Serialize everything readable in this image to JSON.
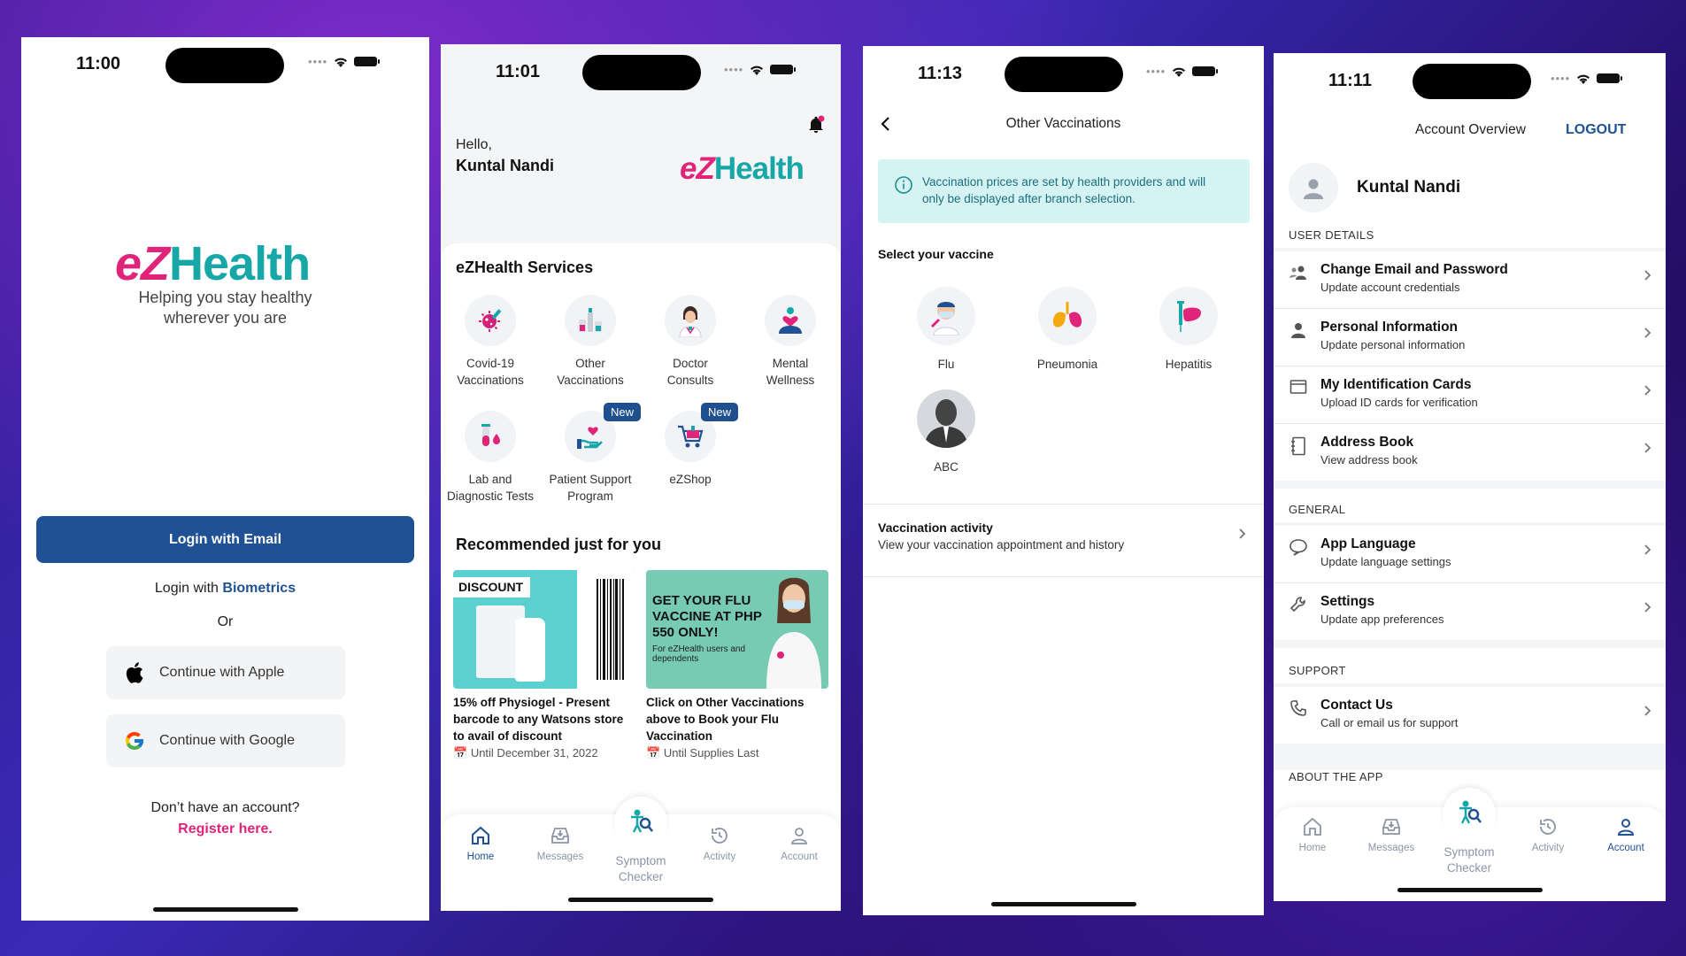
{
  "colors": {
    "brand_blue": "#1f5194",
    "brand_pink": "#e0247a",
    "brand_teal": "#18a7a7",
    "info_bg": "#d4f3f2"
  },
  "logo": {
    "ez": "eZ",
    "health": "Health"
  },
  "screen1": {
    "time": "11:00",
    "tagline_line1": "Helping you stay healthy",
    "tagline_line2": "wherever you are",
    "login_email": "Login with Email",
    "login_with": "Login with ",
    "biometrics": "Biometrics",
    "or": "Or",
    "apple": "Continue with Apple",
    "google": "Continue with Google",
    "no_account": "Don’t have an account?",
    "register": "Register here."
  },
  "screen2": {
    "time": "11:01",
    "hello": "Hello,",
    "user": "Kuntal Nandi",
    "services_title": "eZHealth Services",
    "services": [
      {
        "line1": "Covid-19",
        "line2": "Vaccinations",
        "icon": "virus-syringe-icon"
      },
      {
        "line1": "Other",
        "line2": "Vaccinations",
        "icon": "vaccine-vials-icon"
      },
      {
        "line1": "Doctor",
        "line2": "Consults",
        "icon": "doctor-icon"
      },
      {
        "line1": "Mental",
        "line2": "Wellness",
        "icon": "mental-wellness-icon"
      },
      {
        "line1": "Lab and",
        "line2": "Diagnostic Tests",
        "icon": "test-tube-icon"
      },
      {
        "line1": "Patient Support",
        "line2": "Program",
        "icon": "hand-heart-icon",
        "badge": "New"
      },
      {
        "line1": "eZShop",
        "line2": "",
        "icon": "shopping-cart-icon",
        "badge": "New"
      }
    ],
    "recommended_title": "Recommended just for you",
    "promo1": {
      "tag": "DISCOUNT",
      "text": "15% off Physiogel - Present barcode to any Watsons store to avail of discount",
      "until": "Until December 31, 2022"
    },
    "promo2": {
      "headline": "GET YOUR FLU VACCINE AT PHP 550 ONLY!",
      "sub": "For eZHealth users and dependents",
      "text": "Click on Other Vaccinations above to Book your Flu Vaccination",
      "until": "Until Supplies Last"
    },
    "tabs": {
      "home": "Home",
      "messages": "Messages",
      "symptom1": "Symptom",
      "symptom2": "Checker",
      "activity": "Activity",
      "account": "Account"
    }
  },
  "screen3": {
    "time": "11:13",
    "title": "Other Vaccinations",
    "info_line1": "Vaccination prices are set by health providers and will",
    "info_line2": "only be displayed after branch selection.",
    "select_label": "Select your vaccine",
    "vaccines": [
      {
        "label": "Flu"
      },
      {
        "label": "Pneumonia"
      },
      {
        "label": "Hepatitis"
      },
      {
        "label": "ABC"
      }
    ],
    "activity_title": "Vaccination activity",
    "activity_sub": "View your vaccination appointment and history"
  },
  "screen4": {
    "time": "11:11",
    "title": "Account Overview",
    "logout": "LOGOUT",
    "user": "Kuntal Nandi",
    "user_details": "USER DETAILS",
    "rows_user": [
      {
        "title": "Change Email and Password",
        "sub": "Update account credentials"
      },
      {
        "title": "Personal Information",
        "sub": "Update personal information"
      },
      {
        "title": "My Identification Cards",
        "sub": "Upload ID cards for verification"
      },
      {
        "title": "Address Book",
        "sub": "View address book"
      }
    ],
    "general": "GENERAL",
    "rows_general": [
      {
        "title": "App Language",
        "sub": "Update language settings"
      },
      {
        "title": "Settings",
        "sub": "Update app preferences"
      }
    ],
    "support": "SUPPORT",
    "rows_support": [
      {
        "title": "Contact Us",
        "sub": "Call or email us for support"
      }
    ],
    "about": "ABOUT THE APP"
  }
}
